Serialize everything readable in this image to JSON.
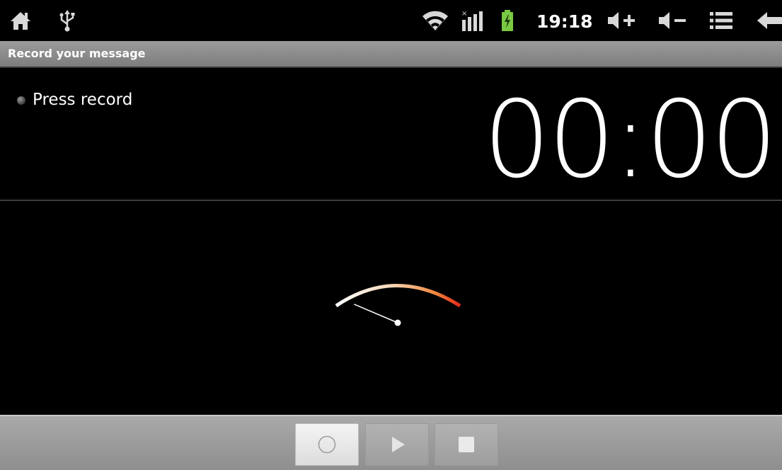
{
  "status_bar": {
    "time": "19:18",
    "icons": [
      "home-icon",
      "usb-icon",
      "wifi-icon",
      "signal-icon",
      "battery-charging-icon",
      "volume-up-icon",
      "volume-down-icon",
      "menu-icon",
      "back-icon"
    ]
  },
  "app": {
    "title": "Record your message"
  },
  "recorder": {
    "state_text": "Press record",
    "elapsed_time": "00:00",
    "level_fraction": 0.0
  },
  "controls": {
    "buttons": [
      "record-icon",
      "play-icon",
      "stop-icon"
    ]
  },
  "colors": {
    "background": "#000000",
    "title_bar": "#8a8a8a",
    "meter_start": "#ffffff",
    "meter_end": "#e8281a",
    "battery": "#7ac943"
  }
}
